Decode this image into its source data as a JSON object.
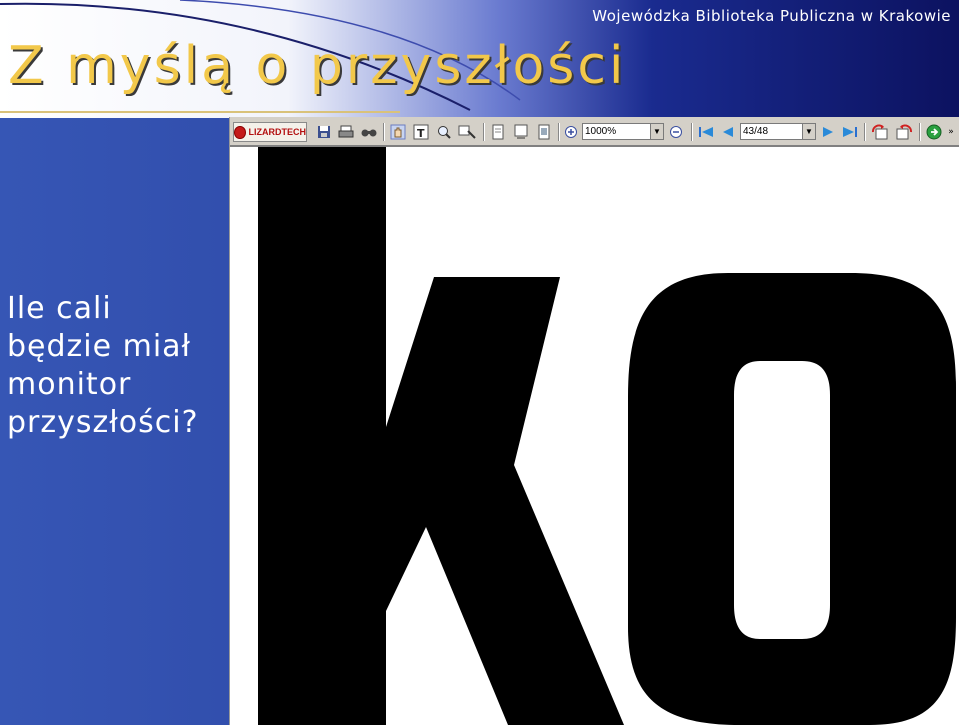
{
  "header": {
    "library_name": "Wojewódzka Biblioteka Publiczna w Krakowie",
    "title": "Z myślą o przyszłości"
  },
  "question": {
    "lines": [
      "Ile cali",
      "będzie miał",
      "monitor",
      "przyszłości?"
    ]
  },
  "viewer": {
    "brand": "LIZARDTECH",
    "zoom_value": "1000%",
    "page_value": "43/48",
    "toolbar_icons": [
      "save-icon",
      "print-icon",
      "find-icon",
      "pan-hand-icon",
      "text-select-icon",
      "zoom-rect-icon",
      "zoom-region-icon",
      "page-view-icon",
      "fit-width-icon",
      "fit-page-icon",
      "zoom-in-icon",
      "zoom-out-icon",
      "first-page-icon",
      "previous-page-icon",
      "next-page-icon",
      "last-page-icon",
      "rotate-left-icon",
      "rotate-right-icon",
      "go-icon"
    ],
    "document_glyphs": "ko"
  },
  "colors": {
    "title": "#f2c84a",
    "slide_blue": "#2f4aa8",
    "header_dark": "#0c1260"
  }
}
